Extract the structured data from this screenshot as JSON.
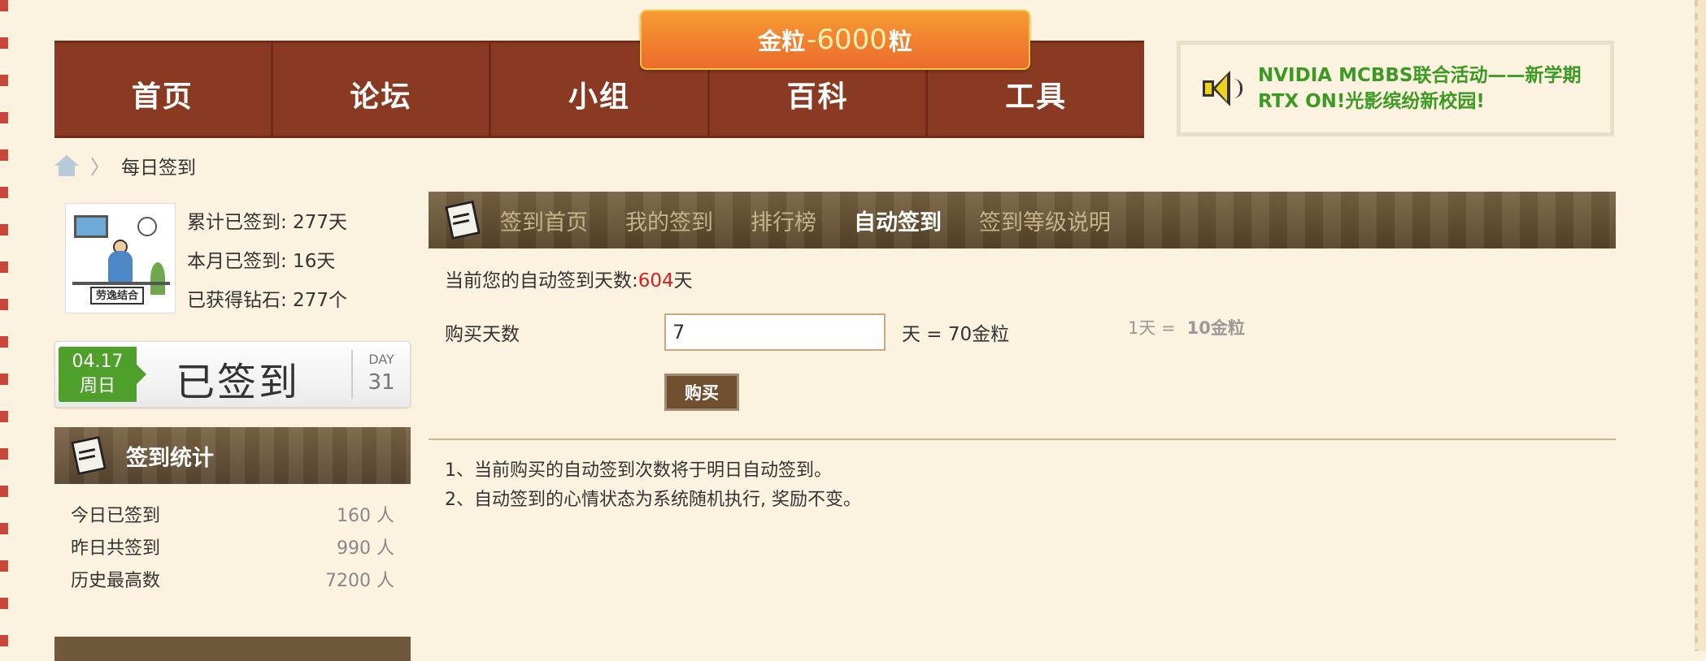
{
  "nav": {
    "items": [
      "首页",
      "论坛",
      "小组",
      "百科",
      "工具"
    ]
  },
  "gold_banner": {
    "prefix": "金粒",
    "amount": "-6000",
    "suffix": "粒"
  },
  "ad": {
    "line1": "NVIDIA MCBBS联合活动——新学期",
    "line2": "RTX ON!光影缤纷新校园!"
  },
  "breadcrumb": {
    "current": "每日签到"
  },
  "user": {
    "avatar_tag": "劳逸结合",
    "total_signed": "累计已签到: 277天",
    "month_signed": "本月已签到: 16天",
    "diamonds": "已获得钻石: 277个"
  },
  "signed_card": {
    "date": "04.17",
    "weekday": "周日",
    "status": "已签到",
    "day_label": "DAY",
    "day_count": "31"
  },
  "stats_panel": {
    "title": "签到统计",
    "rows": [
      {
        "label": "今日已签到",
        "value": "160 人"
      },
      {
        "label": "昨日共签到",
        "value": "990 人"
      },
      {
        "label": "历史最高数",
        "value": "7200 人"
      }
    ]
  },
  "tabs": [
    {
      "label": "签到首页",
      "active": false
    },
    {
      "label": "我的签到",
      "active": false
    },
    {
      "label": "排行榜",
      "active": false
    },
    {
      "label": "自动签到",
      "active": true
    },
    {
      "label": "签到等级说明",
      "active": false
    }
  ],
  "auto_sign": {
    "days_prefix": "当前您的自动签到天数:",
    "days_value": "604",
    "days_suffix": "天",
    "buy_label": "购买天数",
    "buy_input_value": "7",
    "equals_text": "天 = 70金粒",
    "rate_prefix": "1天 =",
    "rate_value": "10金粒",
    "buy_button": "购买"
  },
  "notes": [
    "1、当前购买的自动签到次数将于明日自动签到。",
    "2、自动签到的心情状态为系统随机执行, 奖励不变。"
  ],
  "colors": {
    "nav_bg": "#8a3a22",
    "accent_green": "#3c9a22",
    "badge_green": "#4f9f2b",
    "highlight_red": "#d61f1f"
  }
}
